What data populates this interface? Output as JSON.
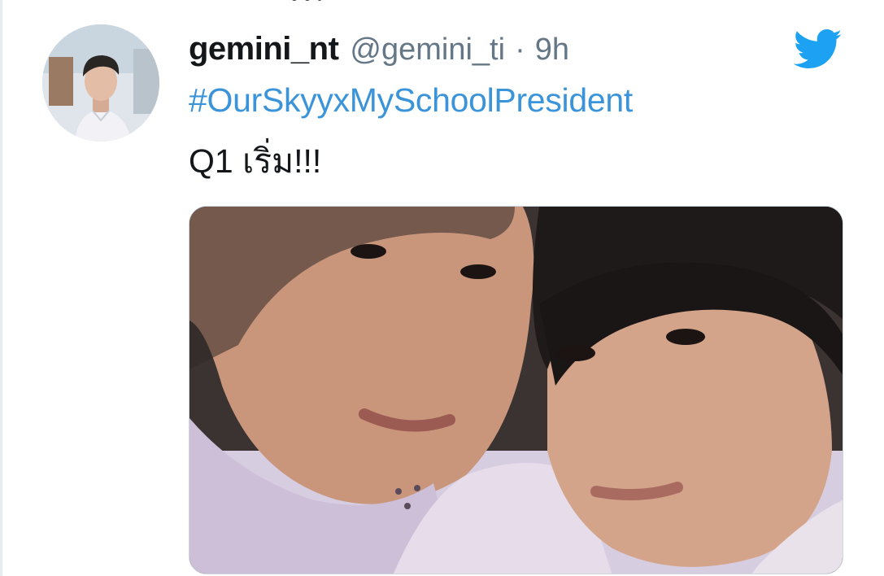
{
  "tweet": {
    "display_name": "gemini_nt",
    "handle": "@gemini_ti",
    "separator": "·",
    "time": "9h",
    "hashtag": "#OurSkyyxMySchoolPresident",
    "text": "Q1 เริ่ม!!!"
  },
  "icons": {
    "brand": "twitter-bird-icon"
  },
  "colors": {
    "name_text": "#14171a",
    "meta_text": "#657786",
    "hashtag": "#3b94d9",
    "twitter_blue": "#1da1f2",
    "media_border": "#ccd6dd"
  }
}
